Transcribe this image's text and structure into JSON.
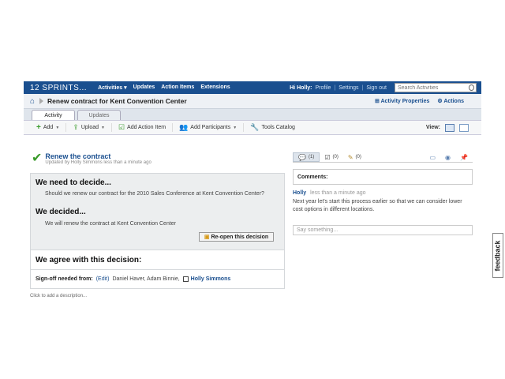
{
  "app": {
    "logo": "12 SPRINTS..."
  },
  "nav": {
    "activities": "Activities ▾",
    "updates": "Updates",
    "action_items": "Action Items",
    "extensions": "Extensions"
  },
  "user": {
    "greeting": "Hi Holly:",
    "profile": "Profile",
    "settings": "Settings",
    "signout": "Sign out"
  },
  "search": {
    "placeholder": "Search Activities"
  },
  "titlebar": {
    "title": "Renew contract for Kent Convention Center",
    "properties": "⊞ Activity Properties",
    "actions": "Actions"
  },
  "tabs": {
    "activity": "Activity",
    "updates": "Updates"
  },
  "toolbar": {
    "add": "Add",
    "upload": "Upload",
    "add_action_item": "Add Action Item",
    "add_participants": "Add Participants",
    "tools_catalog": "Tools Catalog",
    "view": "View:"
  },
  "decision": {
    "title": "Renew the contract",
    "subtitle": "Updated by Holly Simmons less than a minute ago",
    "need_heading": "We need to decide...",
    "need_text": "Should we renew our contract for the 2010 Sales Conference at Kent Convention Center?",
    "decided_heading": "We decided...",
    "decided_text": "We will renew the contract at Kent Convention Center",
    "reopen": "Re-open this decision",
    "agree_heading": "We agree with this decision:",
    "signoff_label": "Sign-off needed from:",
    "edit": "(Edit)",
    "names": "Daniel Haver, Adam Binnie,",
    "holly": "Holly Simmons",
    "description": "Click to add a description..."
  },
  "side": {
    "count_comments": "(1)",
    "count_tasks": "(0)",
    "count_files": "(0)",
    "comments_heading": "Comments:",
    "comment_author": "Holly",
    "comment_time": "less than a minute ago",
    "comment_text": "Next year let's start this process earlier so that we can consider lower cost options in different locations.",
    "say_placeholder": "Say something..."
  },
  "feedback": "feedback"
}
